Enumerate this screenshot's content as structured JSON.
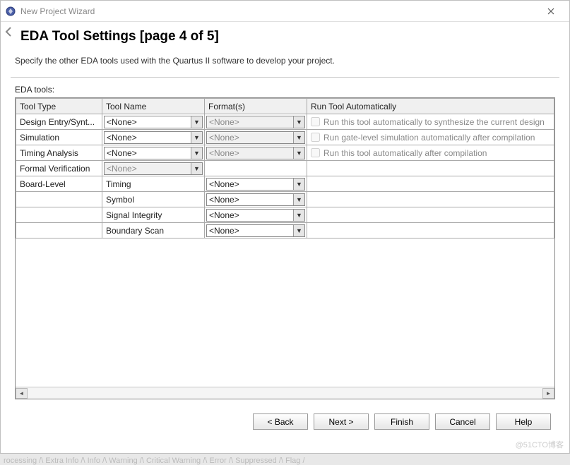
{
  "window": {
    "title": "New Project Wizard",
    "close_label": "✕"
  },
  "page": {
    "heading": "EDA Tool Settings [page 4 of 5]",
    "subtitle": "Specify the other EDA tools used with the Quartus II software to develop your project.",
    "section_label": "EDA tools:"
  },
  "headers": {
    "tool_type": "Tool Type",
    "tool_name": "Tool Name",
    "format": "Format(s)",
    "run_auto": "Run Tool Automatically"
  },
  "rows": {
    "design_entry": {
      "type": "Design Entry/Synt...",
      "name": "<None>",
      "format": "<None>",
      "run_label": "Run this tool automatically to synthesize the current design"
    },
    "simulation": {
      "type": "Simulation",
      "name": "<None>",
      "format": "<None>",
      "run_label": "Run gate-level simulation automatically after compilation"
    },
    "timing": {
      "type": "Timing Analysis",
      "name": "<None>",
      "format": "<None>",
      "run_label": "Run this tool automatically after compilation"
    },
    "formal": {
      "type": "Formal Verification",
      "name": "<None>"
    },
    "board": {
      "type": "Board-Level",
      "sub_timing_label": "Timing",
      "sub_timing_format": "<None>",
      "sub_symbol_label": "Symbol",
      "sub_symbol_format": "<None>",
      "sub_si_label": "Signal Integrity",
      "sub_si_format": "<None>",
      "sub_bs_label": "Boundary Scan",
      "sub_bs_format": "<None>"
    }
  },
  "buttons": {
    "back": "< Back",
    "next": "Next >",
    "finish": "Finish",
    "cancel": "Cancel",
    "help": "Help"
  },
  "background_status": "rocessing /\\ Extra Info /\\ Info /\\ Warning /\\ Critical Warning /\\ Error /\\ Suppressed /\\ Flag /",
  "watermark": "@51CTO博客"
}
